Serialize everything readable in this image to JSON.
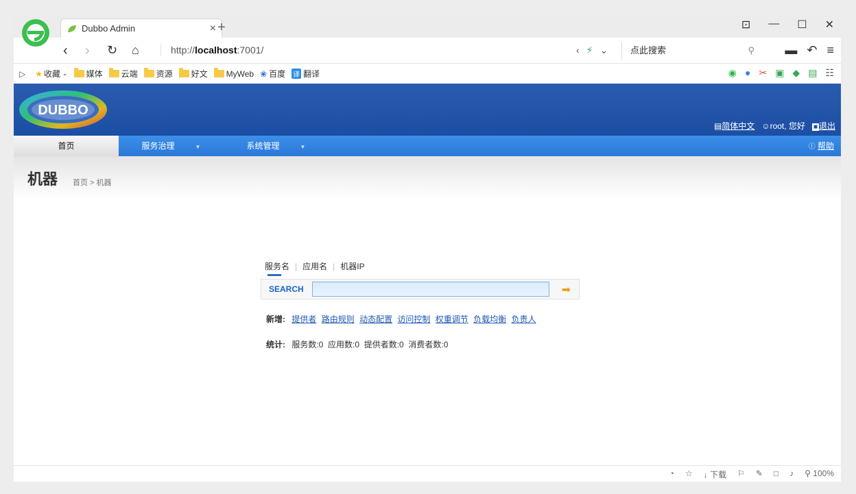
{
  "browser": {
    "tab_title": "Dubbo Admin",
    "tab_close": "×",
    "new_tab": "+",
    "win_controls": [
      "⊡",
      "—",
      "☐",
      "✕"
    ],
    "url_prefix": "http://",
    "url_host": "localhost",
    "url_suffix": ":7001/",
    "search_placeholder": "点此搜索",
    "bookmarks": {
      "sidebar_toggle": "▷",
      "favorites": "收藏",
      "folders": [
        "媒体",
        "云端",
        "资源",
        "好文",
        "MyWeb"
      ],
      "baidu": "百度",
      "translate": "翻译"
    },
    "status": {
      "download": "下载",
      "zoom": "100%"
    }
  },
  "header": {
    "logo_text": "DUBBO",
    "language": "简体中文",
    "user": "root, 您好",
    "logout": "退出"
  },
  "menu": {
    "home": "首页",
    "governance": "服务治理",
    "system": "系统管理",
    "help": "帮助"
  },
  "page": {
    "title": "机器",
    "breadcrumb": "首页 > 机器"
  },
  "search": {
    "tabs": [
      "服务名",
      "应用名",
      "机器IP"
    ],
    "label": "SEARCH",
    "value": ""
  },
  "new_links": {
    "label": "新增:",
    "items": [
      "提供者",
      "路由规则",
      "动态配置",
      "访问控制",
      "权重调节",
      "负载均衡",
      "负责人"
    ]
  },
  "stats": {
    "label": "统计:",
    "services": "服务数:0",
    "apps": "应用数:0",
    "providers": "提供者数:0",
    "consumers": "消费者数:0"
  },
  "colors": {
    "header_blue": "#1b4fa4",
    "menu_blue": "#3c8fe9",
    "link_blue": "#2058b4"
  }
}
